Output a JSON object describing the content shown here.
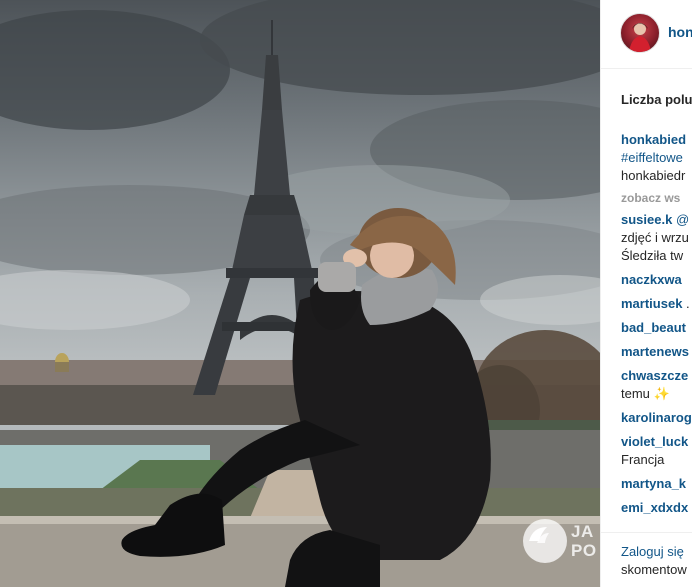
{
  "photo": {
    "alt_subject": "",
    "watermark_line1": "JA",
    "watermark_line2": "PO"
  },
  "header": {
    "username": "hon"
  },
  "likes_text": "Liczba polu",
  "comments": [
    {
      "user": "honkabied",
      "text": ""
    },
    {
      "user": "",
      "text": "#eiffeltowe",
      "tag": true
    },
    {
      "user": "",
      "text": "honkabiedr"
    },
    {
      "user": "",
      "text": "zobacz ws",
      "more": true
    },
    {
      "user": "susiee.k",
      "text": " @"
    },
    {
      "user": "",
      "text": "zdjęć i wrzu"
    },
    {
      "user": "",
      "text": "Śledziła tw"
    },
    {
      "user": "naczkxwa",
      "text": ""
    },
    {
      "user": "martiusek",
      "text": " ."
    },
    {
      "user": "bad_beaut",
      "text": ""
    },
    {
      "user": "martenews",
      "text": ""
    },
    {
      "user": "chwaszcze",
      "text": ""
    },
    {
      "user": "",
      "text": "temu ✨"
    },
    {
      "user": "karolinarog",
      "text": ""
    },
    {
      "user": "violet_luck",
      "text": ""
    },
    {
      "user": "",
      "text": "Francja"
    },
    {
      "user": "martyna_k",
      "text": ""
    },
    {
      "user": "emi_xdxdx",
      "text": ""
    }
  ],
  "footer": {
    "login_link": "Zaloguj się",
    "login_rest": "skomentow"
  },
  "colors": {
    "link_blue": "#125688",
    "text_dark": "#262626",
    "muted": "#999999"
  }
}
